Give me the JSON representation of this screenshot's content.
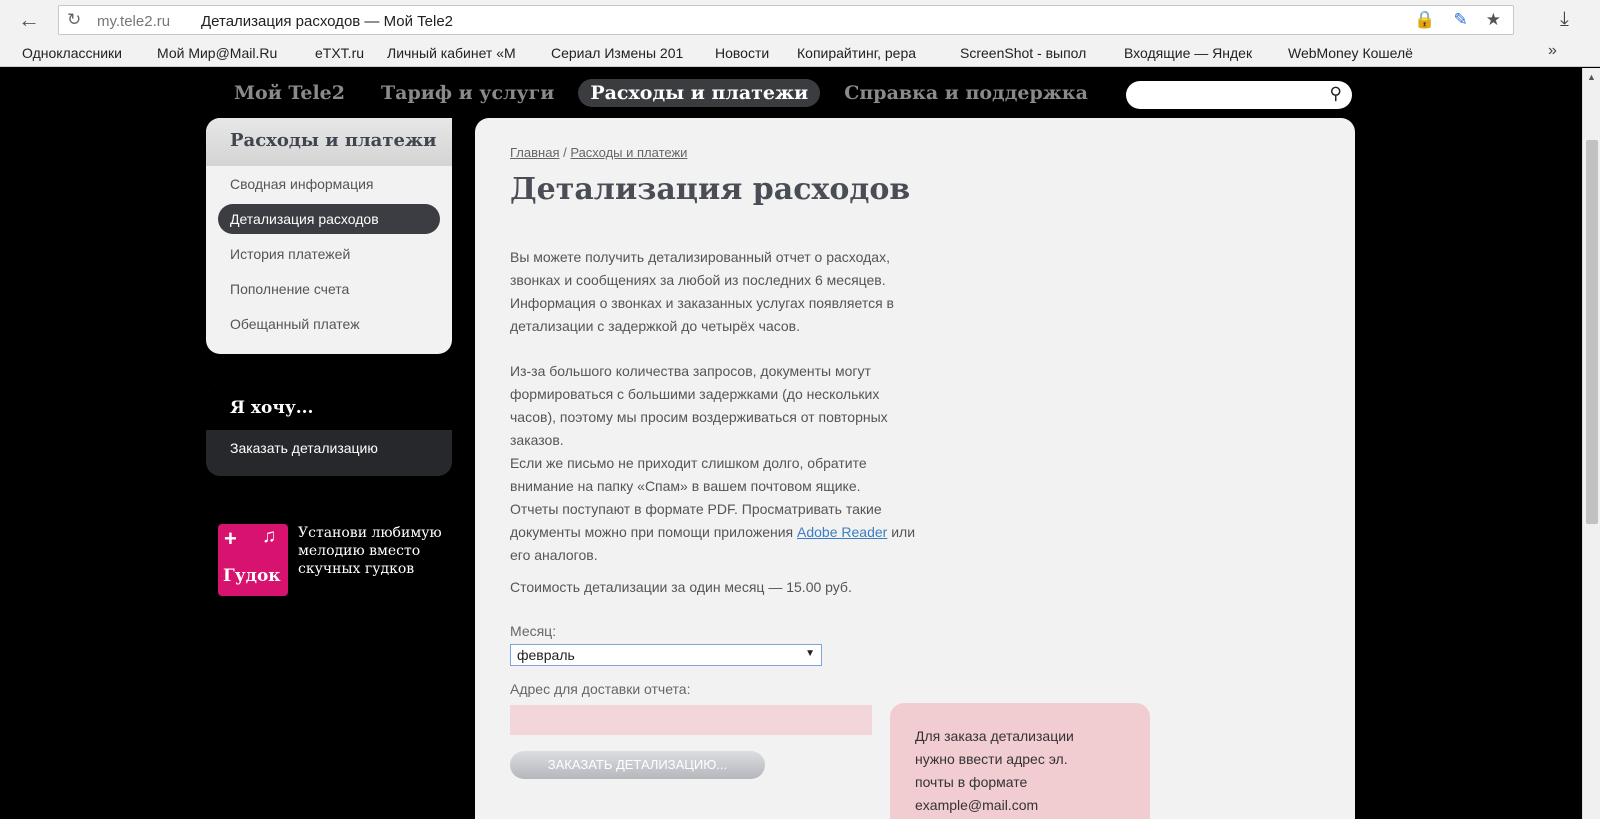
{
  "browser": {
    "url_host": "my.tele2.ru",
    "url_title": "Детализация расходов — Мой Tele2",
    "bookmarks": [
      "Одноклассники",
      "Мой Мир@Mail.Ru",
      "eTXT.ru",
      "Личный кабинет «М",
      "Сериал Измены 201",
      "Новости",
      "Копирайтинг, рера",
      "ScreenShot - выпол",
      "Входящие — Яндек",
      "WebMoney Кошелё"
    ]
  },
  "topnav": {
    "items": [
      "Мой Tele2",
      "Тариф и услуги",
      "Расходы и платежи",
      "Справка и поддержка"
    ],
    "active": "Расходы и платежи"
  },
  "search": {
    "placeholder": ""
  },
  "sidebar": {
    "title": "Расходы и платежи",
    "items": [
      "Сводная информация",
      "Детализация расходов",
      "История платежей",
      "Пополнение счета",
      "Обещанный платеж"
    ],
    "active": "Детализация расходов"
  },
  "want": {
    "title": "Я хочу...",
    "link": "Заказать детализацию"
  },
  "promo": {
    "logo_text": "Гудок",
    "text": "Установи любимую мелодию вместо скучных гудков"
  },
  "main": {
    "breadcrumb_home": "Главная",
    "breadcrumb_sep": " / ",
    "breadcrumb_current": "Расходы и платежи",
    "title": "Детализация расходов",
    "p1_lines": [
      "Вы можете получить детализированный отчет о расходах,",
      "звонках и сообщениях за любой из последних 6 месяцев.",
      "Информация о звонках и заказанных услугах появляется в",
      "детализации с задержкой до четырёх часов."
    ],
    "p2_lines": [
      "Из-за большого количества запросов, документы могут",
      "формироваться с большими задержками (до нескольких",
      "часов), поэтому мы просим воздерживаться от повторных",
      "заказов.",
      "Если же письмо не приходит слишком долго, обратите",
      "внимание на папку «Спам» в вашем почтовом ящике.",
      "Отчеты поступают в формате PDF. Просматривать такие"
    ],
    "p2_last_before_link": "документы можно при помощи приложения ",
    "p2_link": "Adobe Reader",
    "p2_after_link": " или",
    "p2_end": "его аналогов.",
    "cost": "Стоимость детализации за один месяц — 15.00 руб.",
    "month_label": "Месяц:",
    "month_value": "февраль",
    "email_label": "Адрес для доставки отчета:",
    "order_button": "ЗАКАЗАТЬ ДЕТАЛИЗАЦИЮ...",
    "tooltip_lines": [
      "Для заказа детализации",
      "нужно ввести адрес эл.",
      "почты в формате",
      "example@mail.com"
    ]
  }
}
